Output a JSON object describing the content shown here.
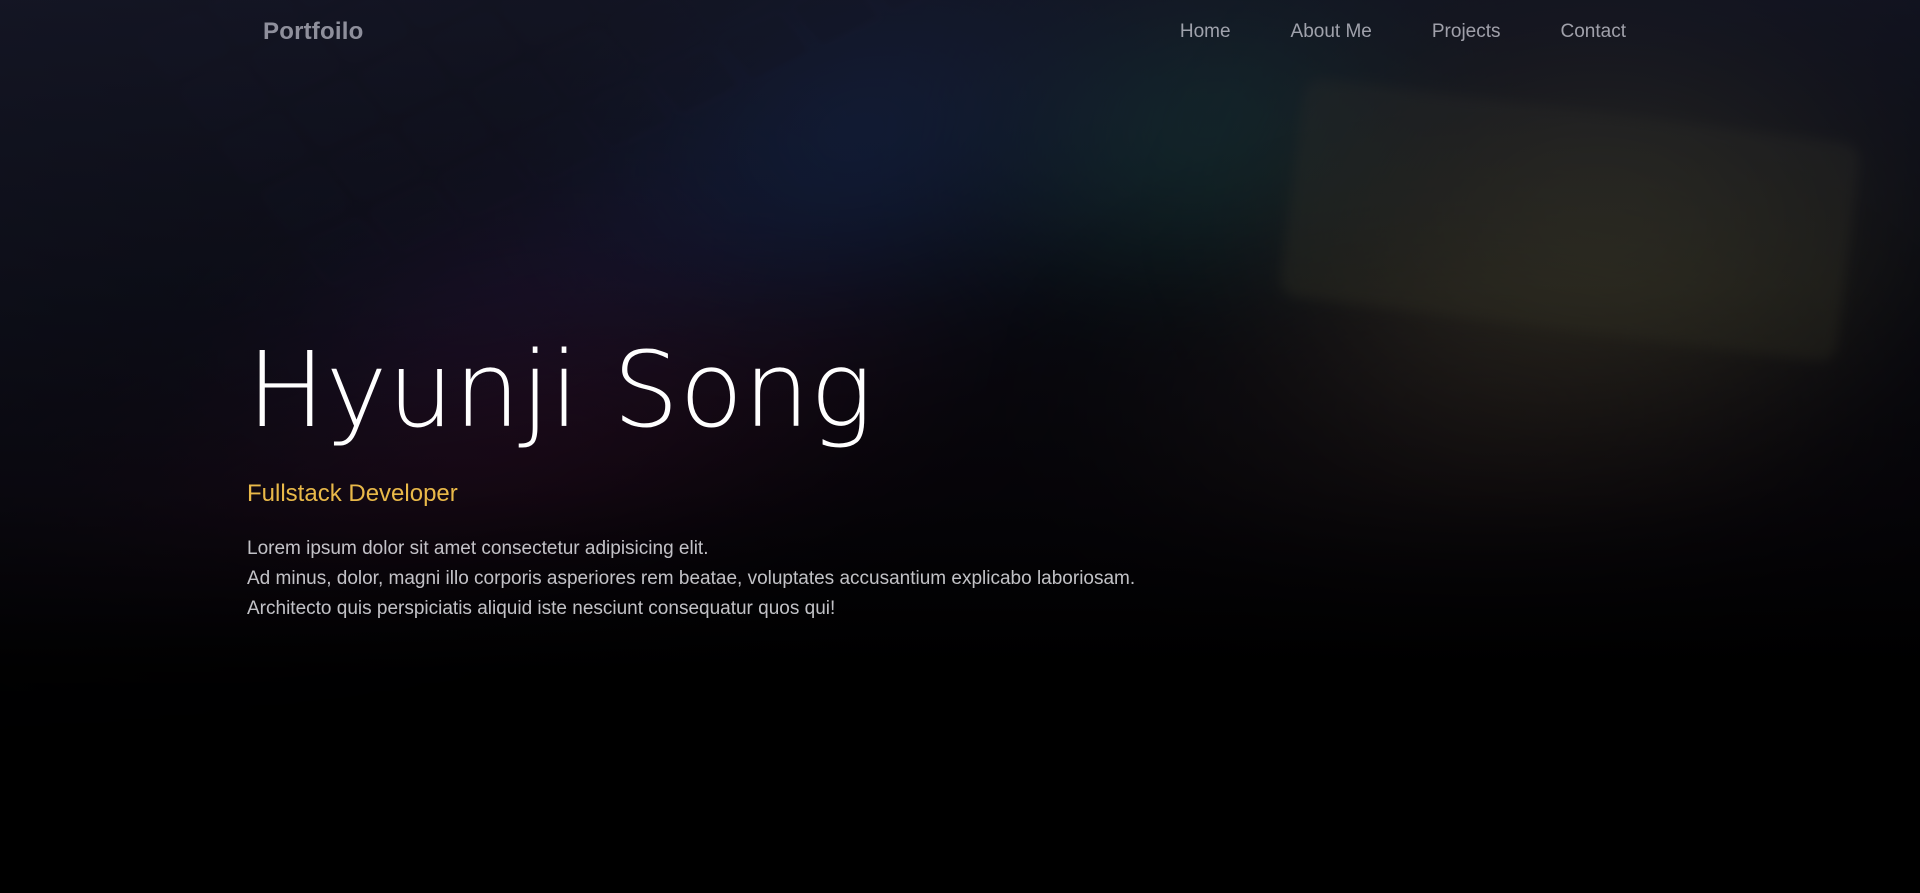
{
  "navbar": {
    "brand": "Portfoilo",
    "links": [
      {
        "label": "Home"
      },
      {
        "label": "About Me"
      },
      {
        "label": "Projects"
      },
      {
        "label": "Contact"
      }
    ]
  },
  "hero": {
    "name": "Hyunji Song",
    "role": "Fullstack Developer",
    "description_lines": [
      "Lorem ipsum dolor sit amet consectetur adipisicing elit.",
      "Ad minus, dolor, magni illo corporis asperiores rem beatae, voluptates accusantium explicabo laboriosam.",
      "Architecto quis perspiciatis aliquid iste nesciunt consequatur quos qui!"
    ],
    "role_color": "#e9b949"
  },
  "background": {
    "image_subject": "blurred-rgb-keyboard",
    "base_color": "#000000"
  }
}
